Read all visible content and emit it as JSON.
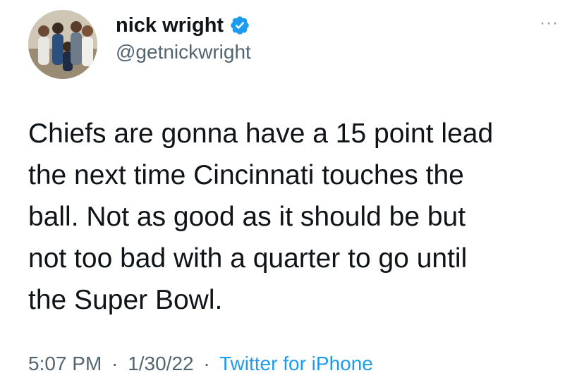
{
  "author": {
    "display_name": "nick wright",
    "handle": "@getnickwright",
    "verified": true
  },
  "tweet": {
    "text_lines": [
      "Chiefs are gonna have a 15 point lead",
      "the next time Cincinnati touches the",
      "ball. Not as good as it should be but",
      "not too bad with a quarter to go until",
      "the Super Bowl."
    ],
    "time": "5:07 PM",
    "separator": "·",
    "date": "1/30/22",
    "source": "Twitter for iPhone"
  },
  "more_button": "···",
  "icons": {
    "verified": "verified-badge-icon",
    "more": "more-options-icon"
  },
  "colors": {
    "text": "#0f1419",
    "secondary": "#536471",
    "accent": "#1d9bf0"
  }
}
